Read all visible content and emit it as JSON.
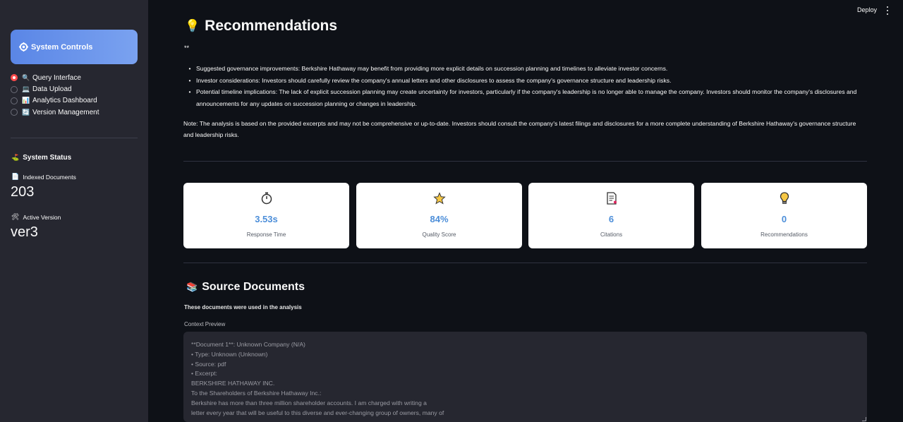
{
  "sidebar": {
    "controls_button": {
      "icon": "gear-icon",
      "label": "System Controls"
    },
    "nav": [
      {
        "icon": "magnifier-icon",
        "emoji": "🔍",
        "label": "Query Interface",
        "selected": true
      },
      {
        "icon": "laptop-icon",
        "emoji": "💻",
        "label": "Data Upload",
        "selected": false
      },
      {
        "icon": "bar-chart-icon",
        "emoji": "📊",
        "label": "Analytics Dashboard",
        "selected": false
      },
      {
        "icon": "refresh-icon",
        "emoji": "🔄",
        "label": "Version Management",
        "selected": false
      }
    ],
    "status_title": "System Status",
    "status_icon": "flag-icon",
    "indexed_label": "Indexed Documents",
    "indexed_icon": "document-icon",
    "indexed_value": "203",
    "version_label": "Active Version",
    "version_icon": "tools-icon",
    "version_value": "ver3"
  },
  "header": {
    "deploy_label": "Deploy",
    "menu_icon": "kebab-menu-icon"
  },
  "recommendations": {
    "icon": "lightbulb-icon",
    "title": "Recommendations",
    "stars": "**",
    "bullets": [
      "Suggested governance improvements: Berkshire Hathaway may benefit from providing more explicit details on succession planning and timelines to alleviate investor concerns.",
      "Investor considerations: Investors should carefully review the company's annual letters and other disclosures to assess the company's governance structure and leadership risks.",
      "Potential timeline implications: The lack of explicit succession planning may create uncertainty for investors, particularly if the company's leadership is no longer able to manage the company. Investors should monitor the company's disclosures and announcements for any updates on succession planning or changes in leadership."
    ],
    "note": "Note: The analysis is based on the provided excerpts and may not be comprehensive or up-to-date. Investors should consult the company's latest filings and disclosures for a more complete understanding of Berkshire Hathaway's governance structure and leadership risks."
  },
  "metrics": [
    {
      "icon": "stopwatch-icon",
      "value": "3.53s",
      "label": "Response Time"
    },
    {
      "icon": "star-icon",
      "value": "84%",
      "label": "Quality Score"
    },
    {
      "icon": "document-icon",
      "value": "6",
      "label": "Citations"
    },
    {
      "icon": "lightbulb-icon",
      "value": "0",
      "label": "Recommendations"
    }
  ],
  "sources": {
    "icon": "books-icon",
    "title": "Source Documents",
    "subtitle": "These documents were used in the analysis",
    "context_label": "Context Preview",
    "context_text": "**Document 1**: Unknown Company (N/A)\n• Type: Unknown (Unknown)\n• Source: pdf\n• Excerpt:\nBERKSHIRE HATHAWAY INC.\nTo the Shareholders of Berkshire Hathaway Inc.:\nBerkshire has more than three million shareholder accounts. I am charged with writing a\nletter every year that will be useful to this diverse and ever-changing group of owners, many of"
  }
}
